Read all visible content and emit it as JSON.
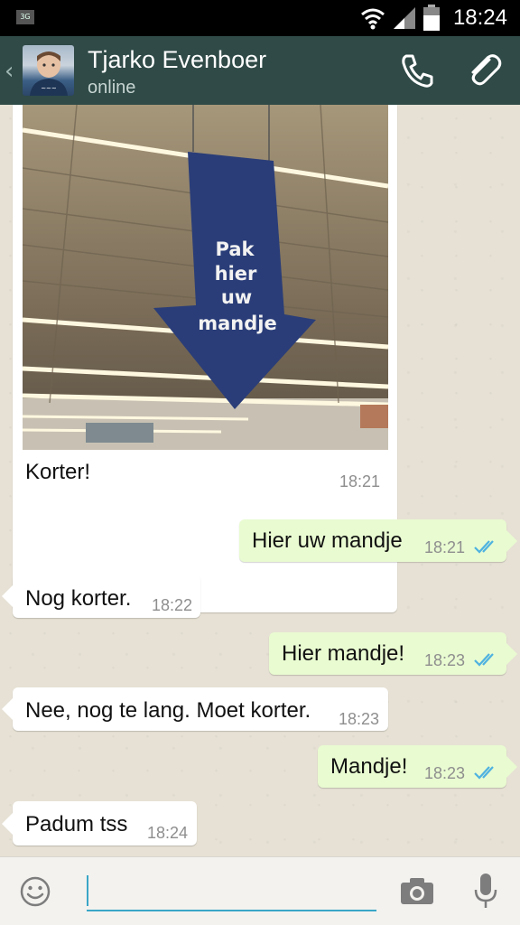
{
  "status_bar": {
    "network": "3G",
    "time": "18:24"
  },
  "header": {
    "contact_name": "Tjarko Evenboer",
    "contact_status": "online",
    "icons": [
      "back-chevron-icon",
      "phone-icon",
      "paperclip-icon"
    ]
  },
  "image_message": {
    "sign_lines": [
      "Pak",
      "hier",
      "uw",
      "mandje"
    ],
    "caption": "Korter!",
    "time": "18:21"
  },
  "messages": [
    {
      "direction": "out",
      "text": "Hier uw mandje",
      "time": "18:21",
      "ticks": "double-check-icon"
    },
    {
      "direction": "in",
      "text": "Nog korter.",
      "time": "18:22"
    },
    {
      "direction": "out",
      "text": "Hier mandje!",
      "time": "18:23",
      "ticks": "double-check-icon"
    },
    {
      "direction": "in",
      "text": "Nee, nog te lang. Moet korter.",
      "time": "18:23"
    },
    {
      "direction": "out",
      "text": "Mandje!",
      "time": "18:23",
      "ticks": "double-check-icon"
    },
    {
      "direction": "in",
      "text": "Padum tss",
      "time": "18:24"
    }
  ],
  "input_bar": {
    "value": "",
    "placeholder": "",
    "icons": [
      "smiley-icon",
      "camera-icon",
      "microphone-icon"
    ]
  },
  "colors": {
    "header": "#2f4a47",
    "outgoing_bubble": "#e9fbd1",
    "incoming_bubble": "#ffffff",
    "read_ticks": "#4fb2e0",
    "input_underline": "#3aa6c6"
  }
}
